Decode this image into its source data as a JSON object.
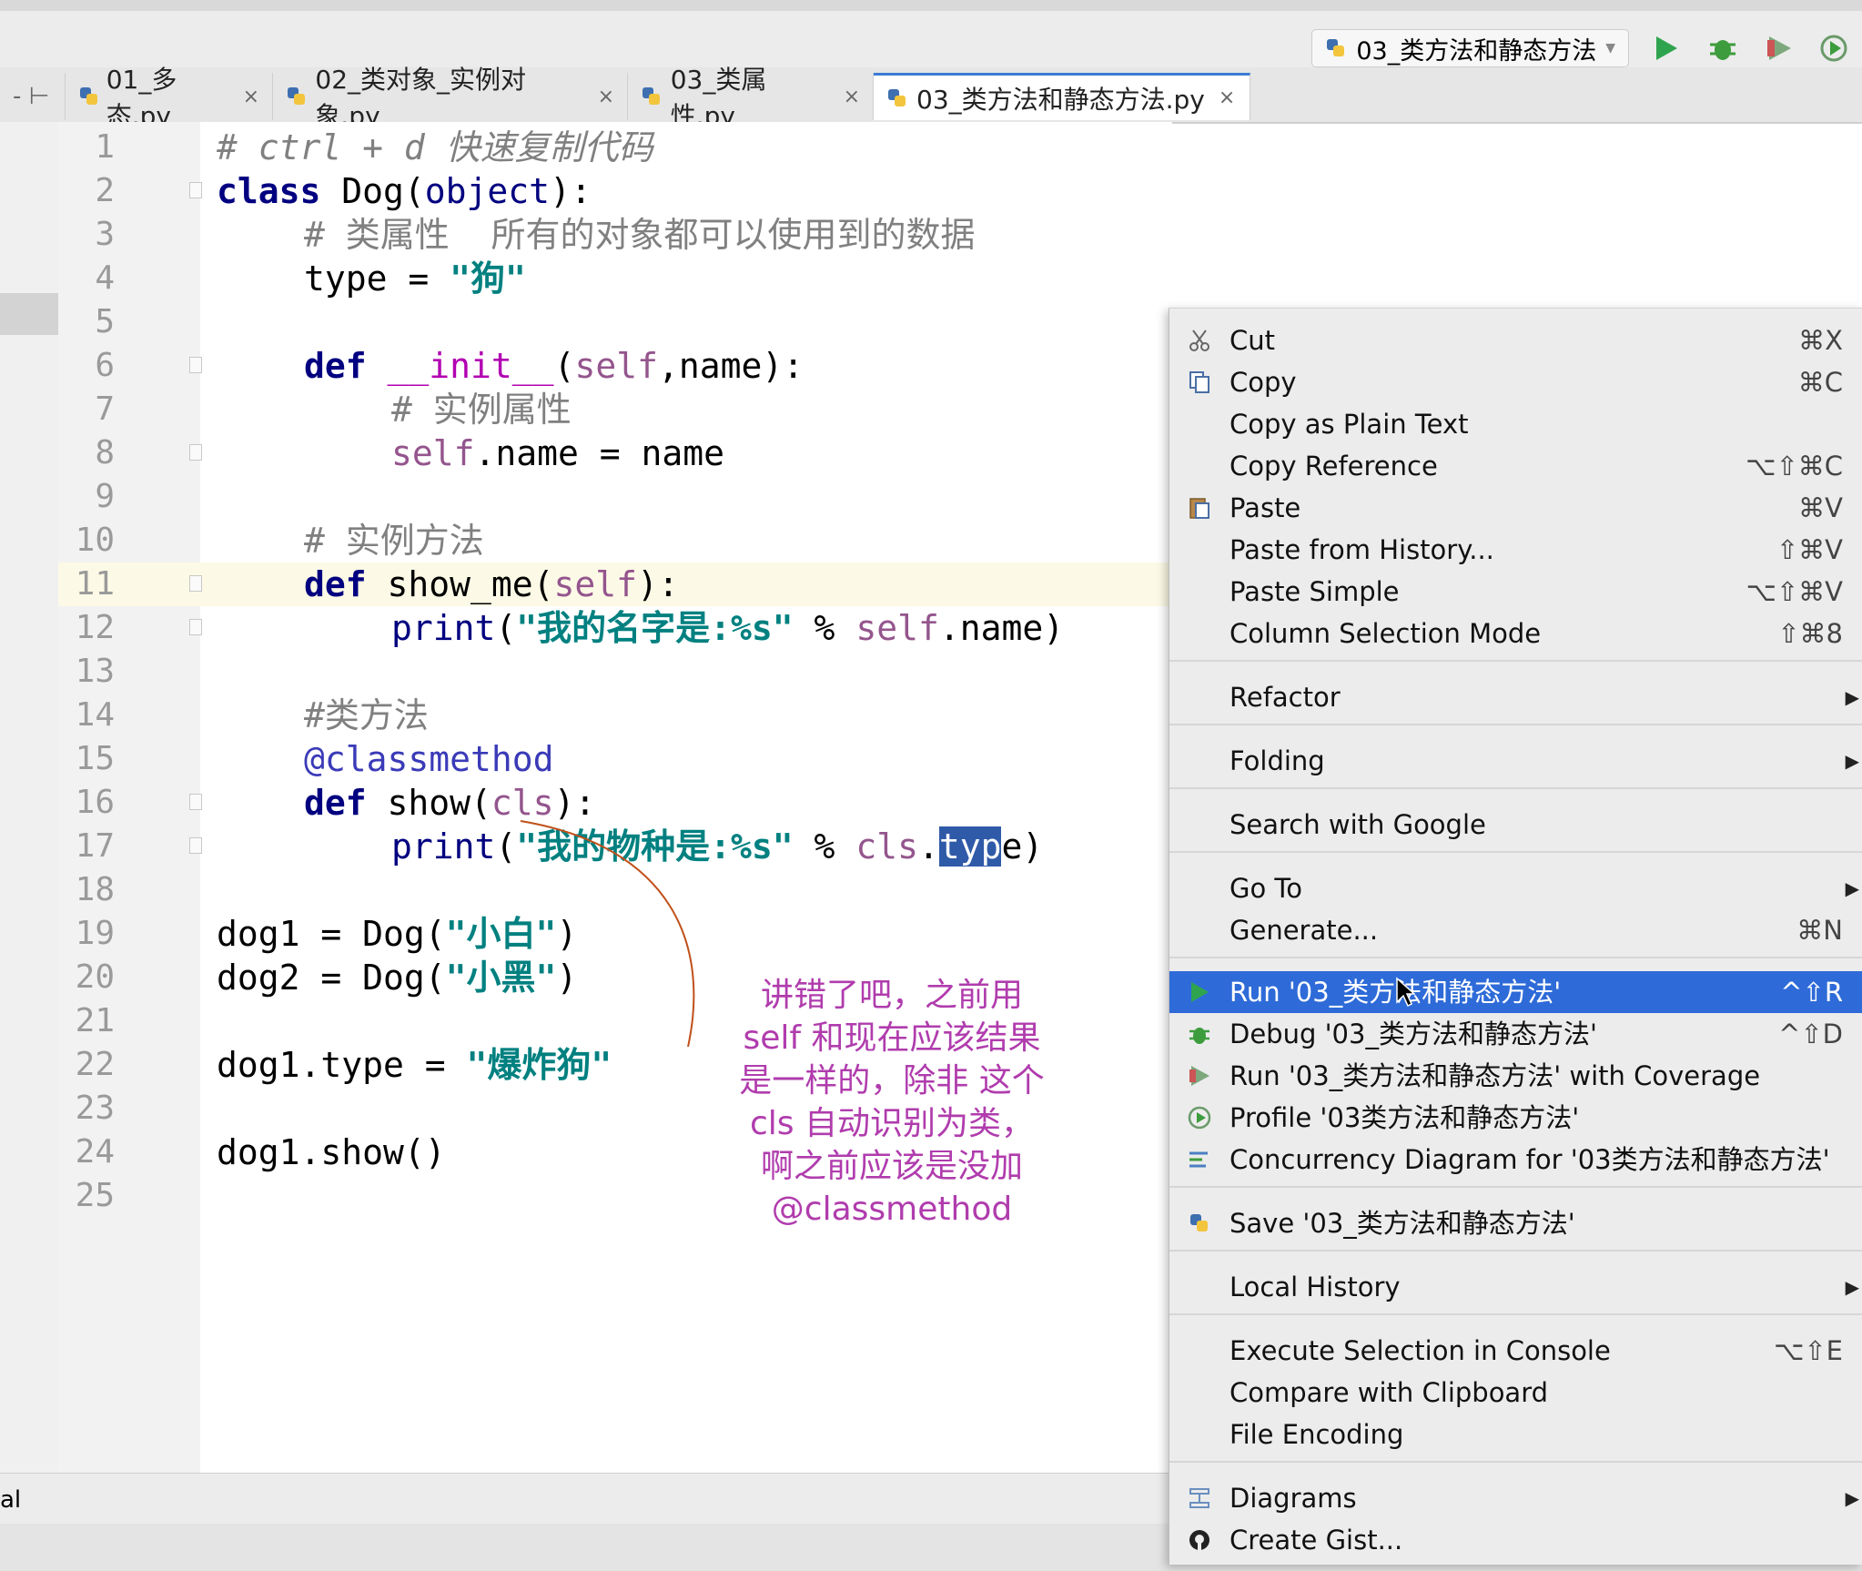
{
  "toolbar": {
    "run_config": "03_类方法和静态方法",
    "run_icon": "run-icon",
    "debug_icon": "debug-icon",
    "coverage_icon": "coverage-icon",
    "profile_icon": "profile-icon"
  },
  "tabs": [
    {
      "label": "01_多态.py",
      "close": "×"
    },
    {
      "label": "02_类对象_实例对象.py",
      "close": "×"
    },
    {
      "label": "03_类属性.py",
      "close": "×"
    },
    {
      "label": "03_类方法和静态方法.py",
      "close": "×",
      "active": true
    }
  ],
  "editor": {
    "current_line": 11,
    "lines": [
      "1",
      "2",
      "3",
      "4",
      "5",
      "6",
      "7",
      "8",
      "9",
      "10",
      "11",
      "12",
      "13",
      "14",
      "15",
      "16",
      "17",
      "18",
      "19",
      "20",
      "21",
      "22",
      "23",
      "24",
      "25"
    ],
    "code": {
      "l1": "# ctrl + d 快速复制代码",
      "l2_kw": "class",
      "l2_rest": " Dog(",
      "l2_obj": "object",
      "l2_end": "):",
      "l3": "# 类属性  所有的对象都可以使用到的数据",
      "l4_a": "type = ",
      "l4_s": "\"狗\"",
      "l6_kw": "def",
      "l6_fn": "__init__",
      "l6_open": "(",
      "l6_self": "self",
      "l6_end": ",name):",
      "l7": "# 实例属性",
      "l8_self": "self",
      "l8_rest": ".name = name",
      "l10": "# 实例方法",
      "l11_kw": "def",
      "l11_fn": " show_me(",
      "l11_self": "self",
      "l11_end": "):",
      "l12_print": "print",
      "l12_open": "(",
      "l12_s": "\"我的名字是:%s\"",
      "l12_mid": " % ",
      "l12_self": "self",
      "l12_end": ".name)",
      "l14": "#类方法",
      "l15": "@classmethod",
      "l16_kw": "def",
      "l16_fn": " show(",
      "l16_cls": "cls",
      "l16_end": "):",
      "l17_print": "print",
      "l17_open": "(",
      "l17_s": "\"我的物种是:%s\"",
      "l17_mid": " % ",
      "l17_cls": "cls",
      "l17_dot": ".",
      "l17_sel": "typ",
      "l17_end": "e)",
      "l19_a": "dog1 = Dog(",
      "l19_s": "\"小白\"",
      "l19_e": ")",
      "l20_a": "dog2 = Dog(",
      "l20_s": "\"小黑\"",
      "l20_e": ")",
      "l22_a": "dog1.type = ",
      "l22_s": "\"爆炸狗\"",
      "l24": "dog1.show()"
    }
  },
  "annotation": {
    "lines": [
      "讲错了吧，之前用",
      "self 和现在应该结果",
      "是一样的，除非 这个",
      "cls 自动识别为类，",
      "啊之前应该是没加",
      "@classmethod"
    ]
  },
  "status": {
    "left_text": "al"
  },
  "context_menu": {
    "items": [
      {
        "label": "Cut",
        "shortcut": "⌘X",
        "icon": "scissors-icon"
      },
      {
        "label": "Copy",
        "shortcut": "⌘C",
        "icon": "copy-icon"
      },
      {
        "label": "Copy as Plain Text",
        "shortcut": ""
      },
      {
        "label": "Copy Reference",
        "shortcut": "⌥⇧⌘C"
      },
      {
        "label": "Paste",
        "shortcut": "⌘V",
        "icon": "paste-icon"
      },
      {
        "label": "Paste from History...",
        "shortcut": "⇧⌘V"
      },
      {
        "label": "Paste Simple",
        "shortcut": "⌥⇧⌘V"
      },
      {
        "label": "Column Selection Mode",
        "shortcut": "⇧⌘8"
      },
      {
        "label": "Refactor",
        "submenu": "▶"
      },
      {
        "label": "Folding",
        "submenu": "▶"
      },
      {
        "label": "Search with Google",
        "shortcut": ""
      },
      {
        "label": "Go To",
        "submenu": "▶"
      },
      {
        "label": "Generate...",
        "shortcut": "⌘N"
      },
      {
        "label": "Run '03_类方法和静态方法'",
        "shortcut": "^⇧R",
        "icon": "run-icon",
        "highlighted": true
      },
      {
        "label": "Debug '03_类方法和静态方法'",
        "shortcut": "^⇧D",
        "icon": "debug-icon"
      },
      {
        "label": "Run '03_类方法和静态方法' with Coverage",
        "shortcut": "",
        "icon": "coverage-icon"
      },
      {
        "label": "Profile '03类方法和静态方法'",
        "shortcut": "",
        "icon": "profile-icon"
      },
      {
        "label": "Concurrency Diagram for  '03类方法和静态方法'",
        "shortcut": "",
        "icon": "concurrency-icon"
      },
      {
        "label": "Save '03_类方法和静态方法'",
        "shortcut": "",
        "icon": "python-icon"
      },
      {
        "label": "Local History",
        "submenu": "▶"
      },
      {
        "label": "Execute Selection in Console",
        "shortcut": "⌥⇧E"
      },
      {
        "label": "Compare with Clipboard",
        "shortcut": ""
      },
      {
        "label": "File Encoding",
        "shortcut": ""
      },
      {
        "label": "Diagrams",
        "submenu": "▶",
        "icon": "diagram-icon"
      },
      {
        "label": "Create Gist...",
        "shortcut": "",
        "icon": "github-icon"
      }
    ]
  },
  "colors": {
    "keyword": "#000080",
    "string": "#008080",
    "comment": "#808080",
    "self": "#94558d",
    "annotation": "#b03cad",
    "menu_highlight": "#2e6bd8"
  }
}
